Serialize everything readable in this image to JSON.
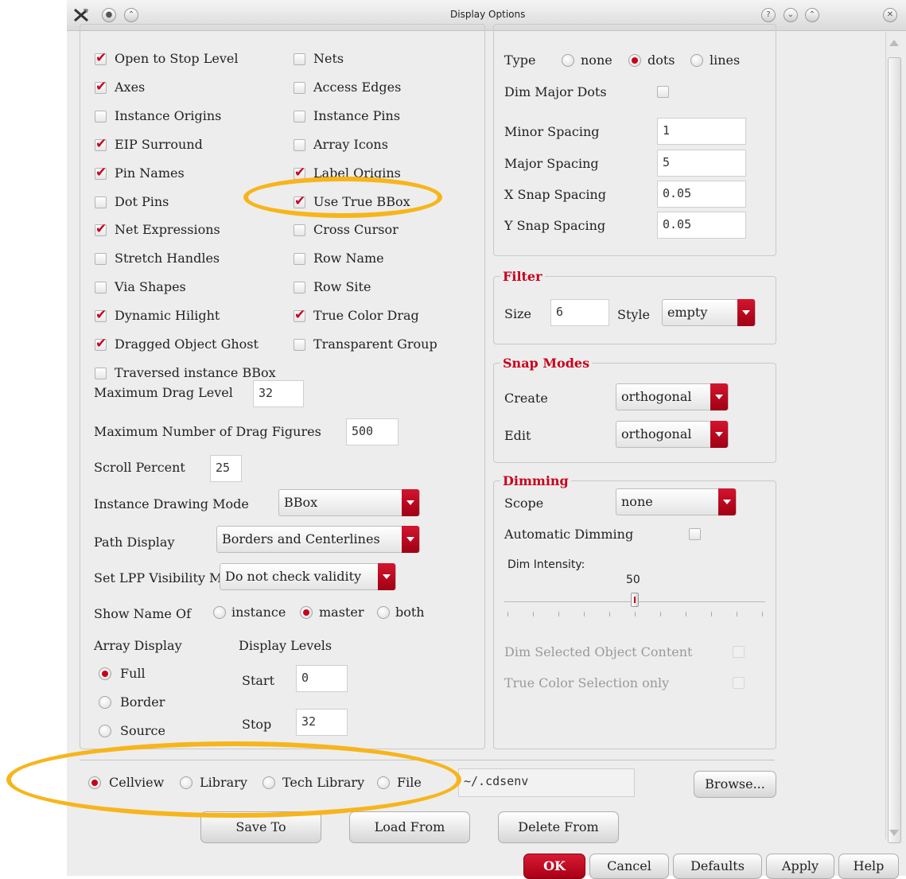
{
  "window": {
    "title": "Display Options",
    "title_buttons": [
      "?",
      "⌄",
      "⌃"
    ],
    "close_label": "✕"
  },
  "left": {
    "col1": [
      {
        "label": "Open to Stop Level",
        "checked": true
      },
      {
        "label": "Axes",
        "checked": true
      },
      {
        "label": "Instance Origins",
        "checked": false
      },
      {
        "label": "EIP Surround",
        "checked": true
      },
      {
        "label": "Pin Names",
        "checked": true
      },
      {
        "label": "Dot Pins",
        "checked": false
      },
      {
        "label": "Net Expressions",
        "checked": true
      },
      {
        "label": "Stretch Handles",
        "checked": false
      },
      {
        "label": "Via Shapes",
        "checked": false
      },
      {
        "label": "Dynamic Hilight",
        "checked": true
      },
      {
        "label": "Dragged Object Ghost",
        "checked": true
      },
      {
        "label": "Traversed instance BBox",
        "checked": false
      }
    ],
    "col2": [
      {
        "label": "Nets",
        "checked": false
      },
      {
        "label": "Access Edges",
        "checked": false
      },
      {
        "label": "Instance Pins",
        "checked": false
      },
      {
        "label": "Array Icons",
        "checked": false
      },
      {
        "label": "Label Origins",
        "checked": true
      },
      {
        "label": "Use True BBox",
        "checked": true
      },
      {
        "label": "Cross Cursor",
        "checked": false
      },
      {
        "label": "Row Name",
        "checked": false
      },
      {
        "label": "Row Site",
        "checked": false
      },
      {
        "label": "True Color Drag",
        "checked": true
      },
      {
        "label": "Transparent Group",
        "checked": false
      }
    ],
    "max_drag_level": {
      "label": "Maximum Drag Level",
      "value": "32"
    },
    "max_drag_figures": {
      "label": "Maximum Number of Drag Figures",
      "value": "500"
    },
    "scroll_percent": {
      "label": "Scroll Percent",
      "value": "25"
    },
    "instance_drawing_mode": {
      "label": "Instance Drawing Mode",
      "value": "BBox"
    },
    "path_display": {
      "label": "Path Display",
      "value": "Borders and Centerlines"
    },
    "lpp_visibility": {
      "label": "Set LPP Visibility M",
      "value": "Do not check validity"
    },
    "show_name_of": {
      "label": "Show Name Of",
      "options": [
        "instance",
        "master",
        "both"
      ],
      "selected": "master"
    },
    "array_display": {
      "label": "Array Display",
      "options": [
        "Full",
        "Border",
        "Source"
      ],
      "selected": "Full"
    },
    "display_levels": {
      "label": "Display Levels",
      "start_label": "Start",
      "start": "0",
      "stop_label": "Stop",
      "stop": "32"
    }
  },
  "grid": {
    "type_label": "Type",
    "type_options": [
      "none",
      "dots",
      "lines"
    ],
    "type_selected": "dots",
    "dim_major_dots": {
      "label": "Dim Major Dots",
      "checked": false
    },
    "minor_spacing": {
      "label": "Minor Spacing",
      "value": "1"
    },
    "major_spacing": {
      "label": "Major Spacing",
      "value": "5"
    },
    "x_snap": {
      "label": "X Snap Spacing",
      "value": "0.05"
    },
    "y_snap": {
      "label": "Y Snap Spacing",
      "value": "0.05"
    }
  },
  "filter": {
    "title": "Filter",
    "size_label": "Size",
    "size": "6",
    "style_label": "Style",
    "style": "empty"
  },
  "snap_modes": {
    "title": "Snap Modes",
    "create_label": "Create",
    "create": "orthogonal",
    "edit_label": "Edit",
    "edit": "orthogonal"
  },
  "dimming": {
    "title": "Dimming",
    "scope_label": "Scope",
    "scope": "none",
    "automatic_label": "Automatic Dimming",
    "automatic": false,
    "intensity_label": "Dim Intensity:",
    "intensity": "50",
    "intensity_fraction": 0.5,
    "dim_selected_label": "Dim Selected Object Content",
    "true_color_selection_label": "True Color Selection only"
  },
  "bottom": {
    "save_options": [
      "Cellview",
      "Library",
      "Tech Library",
      "File"
    ],
    "save_selected": "Cellview",
    "file_path": "~/.cdsenv",
    "browse_label": "Browse...",
    "save_to_label": "Save To",
    "load_from_label": "Load From",
    "delete_from_label": "Delete From",
    "ok_label": "OK",
    "cancel_label": "Cancel",
    "defaults_label": "Defaults",
    "apply_label": "Apply",
    "help_label": "Help"
  },
  "colors": {
    "accent": "#c8001c",
    "highlight": "#f7b51c",
    "background": "#ededed"
  }
}
